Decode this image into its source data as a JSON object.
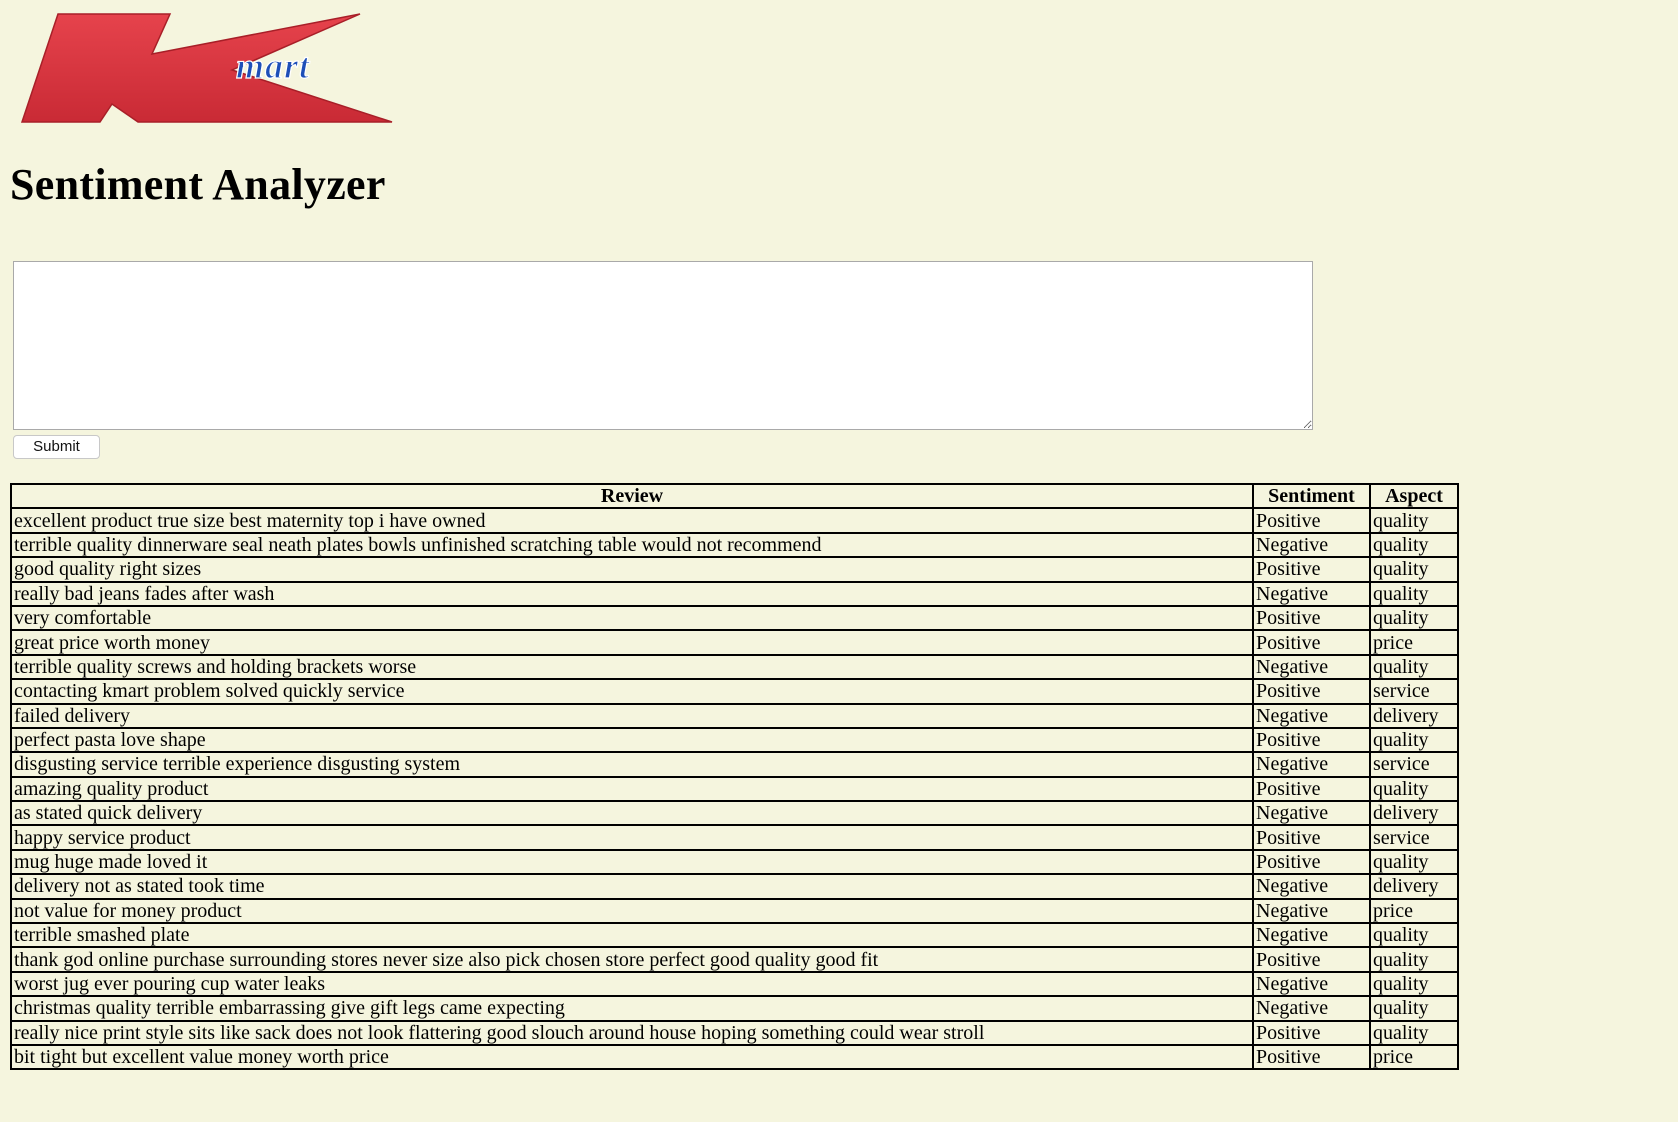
{
  "brand": {
    "logo_text": "mart",
    "logo_letter": "K",
    "logo_red": "#d8343f",
    "logo_blue": "#1e4fb8"
  },
  "page": {
    "title": "Sentiment Analyzer",
    "background": "#f5f5de"
  },
  "form": {
    "textarea_value": "",
    "submit_label": "Submit"
  },
  "table": {
    "headers": {
      "review": "Review",
      "sentiment": "Sentiment",
      "aspect": "Aspect"
    },
    "rows": [
      {
        "review": "excellent product true size best maternity top i have owned",
        "sentiment": "Positive",
        "aspect": "quality"
      },
      {
        "review": "terrible quality dinnerware seal neath plates bowls unfinished scratching table would not recommend",
        "sentiment": "Negative",
        "aspect": "quality"
      },
      {
        "review": "good quality right sizes",
        "sentiment": "Positive",
        "aspect": "quality"
      },
      {
        "review": "really bad jeans fades after wash",
        "sentiment": "Negative",
        "aspect": "quality"
      },
      {
        "review": "very comfortable",
        "sentiment": "Positive",
        "aspect": "quality"
      },
      {
        "review": "great price worth money",
        "sentiment": "Positive",
        "aspect": "price"
      },
      {
        "review": "terrible quality screws and holding brackets worse",
        "sentiment": "Negative",
        "aspect": "quality"
      },
      {
        "review": "contacting kmart problem solved quickly service",
        "sentiment": "Positive",
        "aspect": "service"
      },
      {
        "review": "failed delivery",
        "sentiment": "Negative",
        "aspect": "delivery"
      },
      {
        "review": "perfect pasta love shape",
        "sentiment": "Positive",
        "aspect": "quality"
      },
      {
        "review": "disgusting service terrible experience disgusting system",
        "sentiment": "Negative",
        "aspect": "service"
      },
      {
        "review": "amazing quality product",
        "sentiment": "Positive",
        "aspect": "quality"
      },
      {
        "review": "as stated quick delivery",
        "sentiment": "Negative",
        "aspect": "delivery"
      },
      {
        "review": "happy service product",
        "sentiment": "Positive",
        "aspect": "service"
      },
      {
        "review": "mug huge made loved it",
        "sentiment": "Positive",
        "aspect": "quality"
      },
      {
        "review": "delivery not as stated took time",
        "sentiment": "Negative",
        "aspect": "delivery"
      },
      {
        "review": "not value for money product",
        "sentiment": "Negative",
        "aspect": "price"
      },
      {
        "review": "terrible smashed plate",
        "sentiment": "Negative",
        "aspect": "quality"
      },
      {
        "review": "thank god online purchase surrounding stores never size also pick chosen store perfect good quality good fit",
        "sentiment": "Positive",
        "aspect": "quality"
      },
      {
        "review": "worst jug ever pouring cup water leaks",
        "sentiment": "Negative",
        "aspect": "quality"
      },
      {
        "review": "christmas quality terrible embarrassing give gift legs came expecting",
        "sentiment": "Negative",
        "aspect": "quality"
      },
      {
        "review": "really nice print style sits like sack does not look flattering good slouch around house hoping something could wear stroll",
        "sentiment": "Positive",
        "aspect": "quality"
      },
      {
        "review": "bit tight but excellent value money worth price",
        "sentiment": "Positive",
        "aspect": "price"
      }
    ]
  }
}
